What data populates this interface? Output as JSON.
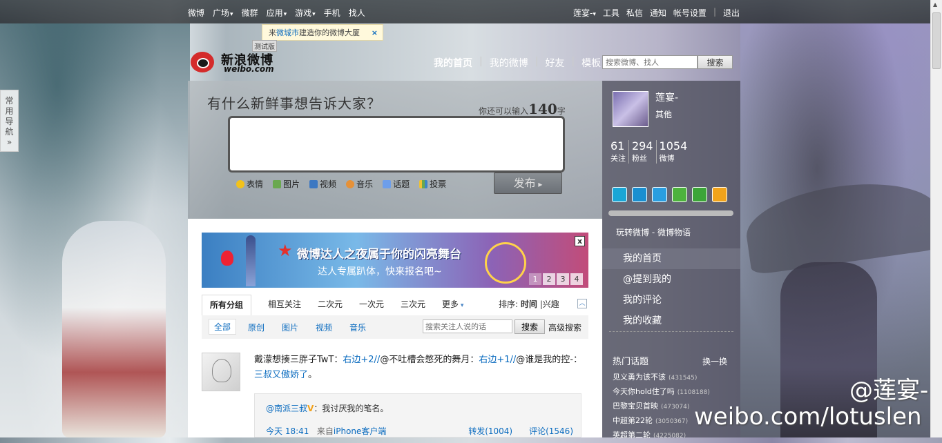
{
  "topbar": {
    "nav": [
      {
        "label": "微博",
        "caret": false
      },
      {
        "label": "广场",
        "caret": true
      },
      {
        "label": "微群",
        "caret": false
      },
      {
        "label": "应用",
        "caret": true
      },
      {
        "label": "游戏",
        "caret": true
      },
      {
        "label": "手机",
        "caret": false
      },
      {
        "label": "找人",
        "caret": false
      }
    ],
    "user_menu": "莲宴-",
    "right": [
      "工具",
      "私信",
      "通知",
      "帐号设置"
    ],
    "logout": "退出"
  },
  "tip": {
    "prefix": "来",
    "link": "微城市",
    "suffix": "建造你的微博大厦",
    "close": "×"
  },
  "quicknav": "常用导航",
  "logo": {
    "name": "新浪微博",
    "url": "weibo.com",
    "beta": "测试版"
  },
  "mainnav": [
    "我的首页",
    "我的微博",
    "好友",
    "模板"
  ],
  "search": {
    "placeholder": "搜索微博、找人",
    "button": "搜索"
  },
  "publisher": {
    "prompt": "有什么新鲜事想告诉大家？",
    "count_prefix": "你还可以输入",
    "count": "140",
    "count_suffix": "字",
    "tools": [
      "表情",
      "图片",
      "视频",
      "音乐",
      "话题",
      "投票"
    ],
    "submit": "发布"
  },
  "banner": {
    "title": "微博达人之夜属于你的闪亮舞台",
    "subtitle": "达人专属趴体，快来报名吧~",
    "pages": [
      "1",
      "2",
      "3",
      "4"
    ],
    "close": "x"
  },
  "tabs": {
    "groups": [
      "所有分组",
      "相互关注",
      "二次元",
      "一次元",
      "三次元",
      "更多"
    ],
    "sort_label": "排序:",
    "sort_time": "时间",
    "sort_sep": "|",
    "sort_hot": "兴趣"
  },
  "filters": {
    "items": [
      "全部",
      "原创",
      "图片",
      "视频",
      "音乐"
    ],
    "search_placeholder": "搜索关注人说的话",
    "search_button": "搜索",
    "advanced": "高级搜索"
  },
  "post": {
    "text_a": "戴濛想揍三胖子TwT：",
    "link_a": "右边+2//",
    "text_b": "@不吐槽会憋死的舞月：",
    "link_b": "右边+1//",
    "text_c": "@谁是我的控-：",
    "link_c": "三叔又傲娇了",
    "text_d": "。",
    "quote_user": "@南派三叔",
    "quote_text": "：我讨厌我的笔名。",
    "time": "今天  18:41",
    "source_prefix": "来自",
    "source": "iPhone客户端",
    "repost": "转发(1004)",
    "comment": "评论(1546)"
  },
  "sidebar": {
    "name": "莲宴-",
    "location": "其他",
    "stats": [
      {
        "n": "61",
        "l": "关注"
      },
      {
        "n": "294",
        "l": "粉丝"
      },
      {
        "n": "1054",
        "l": "微博"
      }
    ],
    "promo": "玩转微博 - 微博物语",
    "nav": [
      "我的首页",
      "@提到我的",
      "我的评论",
      "我的收藏"
    ],
    "hot_title": "热门话题",
    "hot_change": "换一换",
    "hot": [
      {
        "t": "见义勇为该不该",
        "c": "(431545)"
      },
      {
        "t": "今天你hold住了吗",
        "c": "(1108188)"
      },
      {
        "t": "巴黎宝贝首映",
        "c": "(473074)"
      },
      {
        "t": "中超第22轮",
        "c": "(3050367)"
      },
      {
        "t": "英超第二轮",
        "c": "(4225082)"
      }
    ]
  },
  "watermark": {
    "line1": "@莲宴-",
    "line2": "weibo.com/lotuslen"
  },
  "colors": {
    "link": "#0a6bbf",
    "brand": "#d42b2b",
    "sidebar": "#464854"
  }
}
